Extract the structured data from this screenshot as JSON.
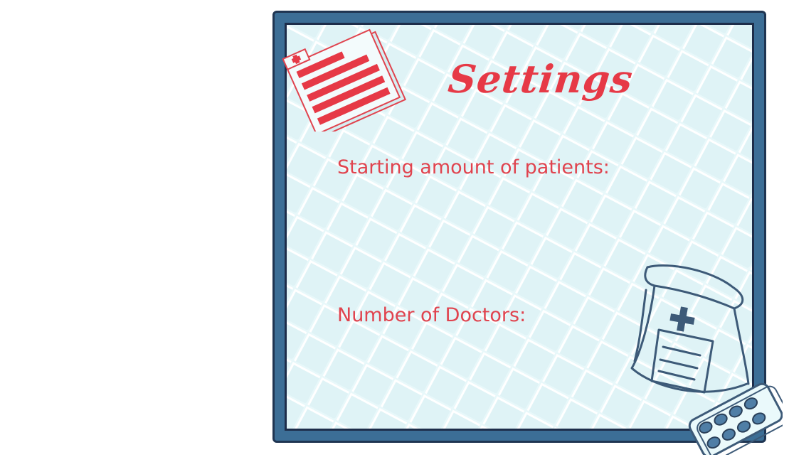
{
  "settings": {
    "title": "Settings",
    "patients_label": "Starting amount of patients:",
    "doctors_label": "Number of Doctors:"
  },
  "icons": {
    "clipboard": "medical-chart-icon",
    "bag": "medicine-bag-icon",
    "pills": "pill-blister-icon"
  },
  "colors": {
    "accent_red": "#e63946",
    "frame_blue": "#3c6e96",
    "frame_dark": "#1d2d4a",
    "background": "#eaf9fb"
  }
}
